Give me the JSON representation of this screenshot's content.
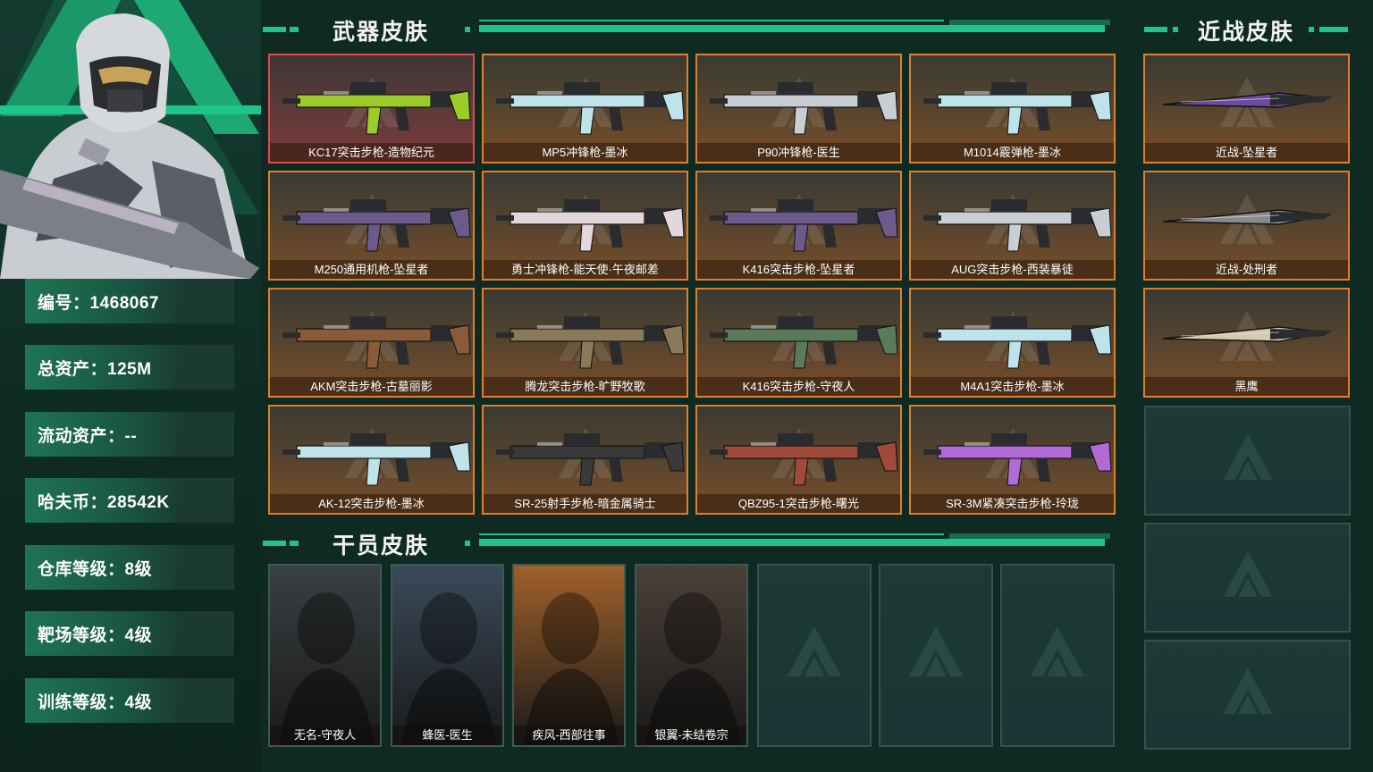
{
  "profile": {
    "stats": [
      {
        "text": "编号：1468067"
      },
      {
        "text": "总资产：125M"
      },
      {
        "text": "流动资产：--"
      },
      {
        "text": "哈夫币：28542K"
      },
      {
        "text": "仓库等级：8级"
      },
      {
        "text": "靶场等级：4级"
      },
      {
        "text": "训练等级：4级"
      }
    ]
  },
  "sections": {
    "weapon_title": "武器皮肤",
    "melee_title": "近战皮肤",
    "operator_title": "干员皮肤"
  },
  "weapons": [
    {
      "label": "KC17突击步枪-造物纪元",
      "rarity": "red",
      "color": "#9ccc2a",
      "icon": "rifle-icon"
    },
    {
      "label": "MP5冲锋枪-墨冰",
      "rarity": "orange",
      "color": "#bfe3ea",
      "icon": "smg-icon"
    },
    {
      "label": "P90冲锋枪-医生",
      "rarity": "orange",
      "color": "#c9cdd4",
      "icon": "smg-icon"
    },
    {
      "label": "M1014霰弹枪-墨冰",
      "rarity": "orange",
      "color": "#bfe3ea",
      "icon": "shotgun-icon"
    },
    {
      "label": "M250通用机枪-坠星者",
      "rarity": "orange",
      "color": "#6b5a8a",
      "icon": "lmg-icon"
    },
    {
      "label": "勇士冲锋枪-能天使·午夜邮差",
      "rarity": "orange",
      "color": "#e2d8dc",
      "icon": "smg-icon"
    },
    {
      "label": "K416突击步枪-坠星者",
      "rarity": "orange",
      "color": "#6b5a8a",
      "icon": "rifle-icon"
    },
    {
      "label": "AUG突击步枪-西装暴徒",
      "rarity": "orange",
      "color": "#c9cdd4",
      "icon": "rifle-icon"
    },
    {
      "label": "AKM突击步枪-古墓丽影",
      "rarity": "orange",
      "color": "#8a5a3a",
      "icon": "rifle-icon"
    },
    {
      "label": "腾龙突击步枪-旷野牧歌",
      "rarity": "orange",
      "color": "#8a7a5a",
      "icon": "rifle-icon"
    },
    {
      "label": "K416突击步枪-守夜人",
      "rarity": "orange",
      "color": "#5a7a5a",
      "icon": "rifle-icon"
    },
    {
      "label": "M4A1突击步枪-墨冰",
      "rarity": "orange",
      "color": "#bfe3ea",
      "icon": "rifle-icon"
    },
    {
      "label": "AK-12突击步枪-墨冰",
      "rarity": "orange",
      "color": "#bfe3ea",
      "icon": "rifle-icon"
    },
    {
      "label": "SR-25射手步枪-暗金属骑士",
      "rarity": "orange",
      "color": "#3a3a3a",
      "icon": "sniper-icon"
    },
    {
      "label": "QBZ95-1突击步枪-曙光",
      "rarity": "orange",
      "color": "#a04a3a",
      "icon": "rifle-icon"
    },
    {
      "label": "SR-3M紧凑突击步枪-玲珑",
      "rarity": "orange",
      "color": "#b46ad6",
      "icon": "rifle-icon"
    }
  ],
  "melee": [
    {
      "label": "近战-坠星者",
      "color": "#6b4aa0",
      "icon": "knife-icon"
    },
    {
      "label": "近战-处刑者",
      "color": "#8a8a8a",
      "icon": "knife-icon"
    },
    {
      "label": "黑鹰",
      "color": "#d8c8b0",
      "icon": "knife-icon"
    }
  ],
  "operators": [
    {
      "label": "无名-守夜人",
      "color": "#3a3f42",
      "icon": "operator-portrait"
    },
    {
      "label": "蜂医-医生",
      "color": "#3a4a5a",
      "icon": "operator-portrait"
    },
    {
      "label": "疾风-西部往事",
      "color": "#a0602a",
      "icon": "operator-portrait"
    },
    {
      "label": "银翼-未结卷宗",
      "color": "#4a4038",
      "icon": "operator-portrait"
    }
  ],
  "colors": {
    "accent": "#1ec48a",
    "border_orange": "#e07f2a",
    "border_red": "#e04a4a",
    "background": "#0f2a22"
  }
}
